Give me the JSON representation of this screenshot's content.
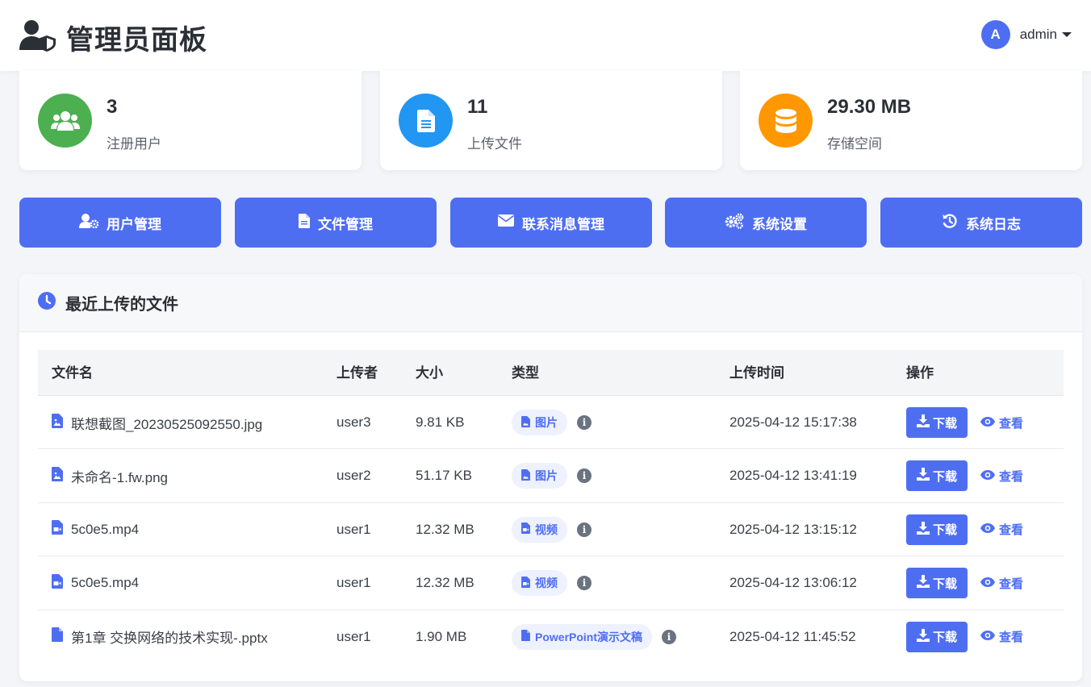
{
  "header": {
    "title": "管理员面板",
    "avatar_initial": "A",
    "username": "admin",
    "icons": {
      "brand": "user-shield-icon",
      "caret": "caret-down-icon"
    }
  },
  "stats": [
    {
      "value": "3",
      "label": "注册用户",
      "icon": "users-icon",
      "color": "#4caf50"
    },
    {
      "value": "11",
      "label": "上传文件",
      "icon": "file-icon",
      "color": "#2196f3"
    },
    {
      "value": "29.30 MB",
      "label": "存储空间",
      "icon": "database-icon",
      "color": "#ff9800"
    }
  ],
  "actions": [
    {
      "label": "用户管理",
      "icon": "users-cog-icon"
    },
    {
      "label": "文件管理",
      "icon": "file-icon"
    },
    {
      "label": "联系消息管理",
      "icon": "envelope-icon"
    },
    {
      "label": "系统设置",
      "icon": "cogs-icon"
    },
    {
      "label": "系统日志",
      "icon": "history-icon"
    }
  ],
  "recent": {
    "title": "最近上传的文件",
    "icon": "clock-icon",
    "columns": [
      "文件名",
      "上传者",
      "大小",
      "类型",
      "上传时间",
      "操作"
    ],
    "download_label": "下载",
    "view_label": "查看",
    "rows": [
      {
        "name": "联想截图_20230525092550.jpg",
        "uploader": "user3",
        "size": "9.81 KB",
        "type": "图片",
        "type_icon": "file-image-icon",
        "time": "2025-04-12 15:17:38"
      },
      {
        "name": "未命名-1.fw.png",
        "uploader": "user2",
        "size": "51.17 KB",
        "type": "图片",
        "type_icon": "file-image-icon",
        "time": "2025-04-12 13:41:19"
      },
      {
        "name": "5c0e5.mp4",
        "uploader": "user1",
        "size": "12.32 MB",
        "type": "视频",
        "type_icon": "file-video-icon",
        "time": "2025-04-12 13:15:12"
      },
      {
        "name": "5c0e5.mp4",
        "uploader": "user1",
        "size": "12.32 MB",
        "type": "视频",
        "type_icon": "file-video-icon",
        "time": "2025-04-12 13:06:12"
      },
      {
        "name": "第1章 交换网络的技术实现-.pptx",
        "uploader": "user1",
        "size": "1.90 MB",
        "type": "PowerPoint演示文稿",
        "type_icon": "file-icon",
        "time": "2025-04-12 11:45:52"
      }
    ]
  },
  "colors": {
    "primary": "#4e6ef2",
    "background": "#f3f5f9",
    "success": "#4caf50",
    "info": "#2196f3",
    "warning": "#ff9800"
  }
}
